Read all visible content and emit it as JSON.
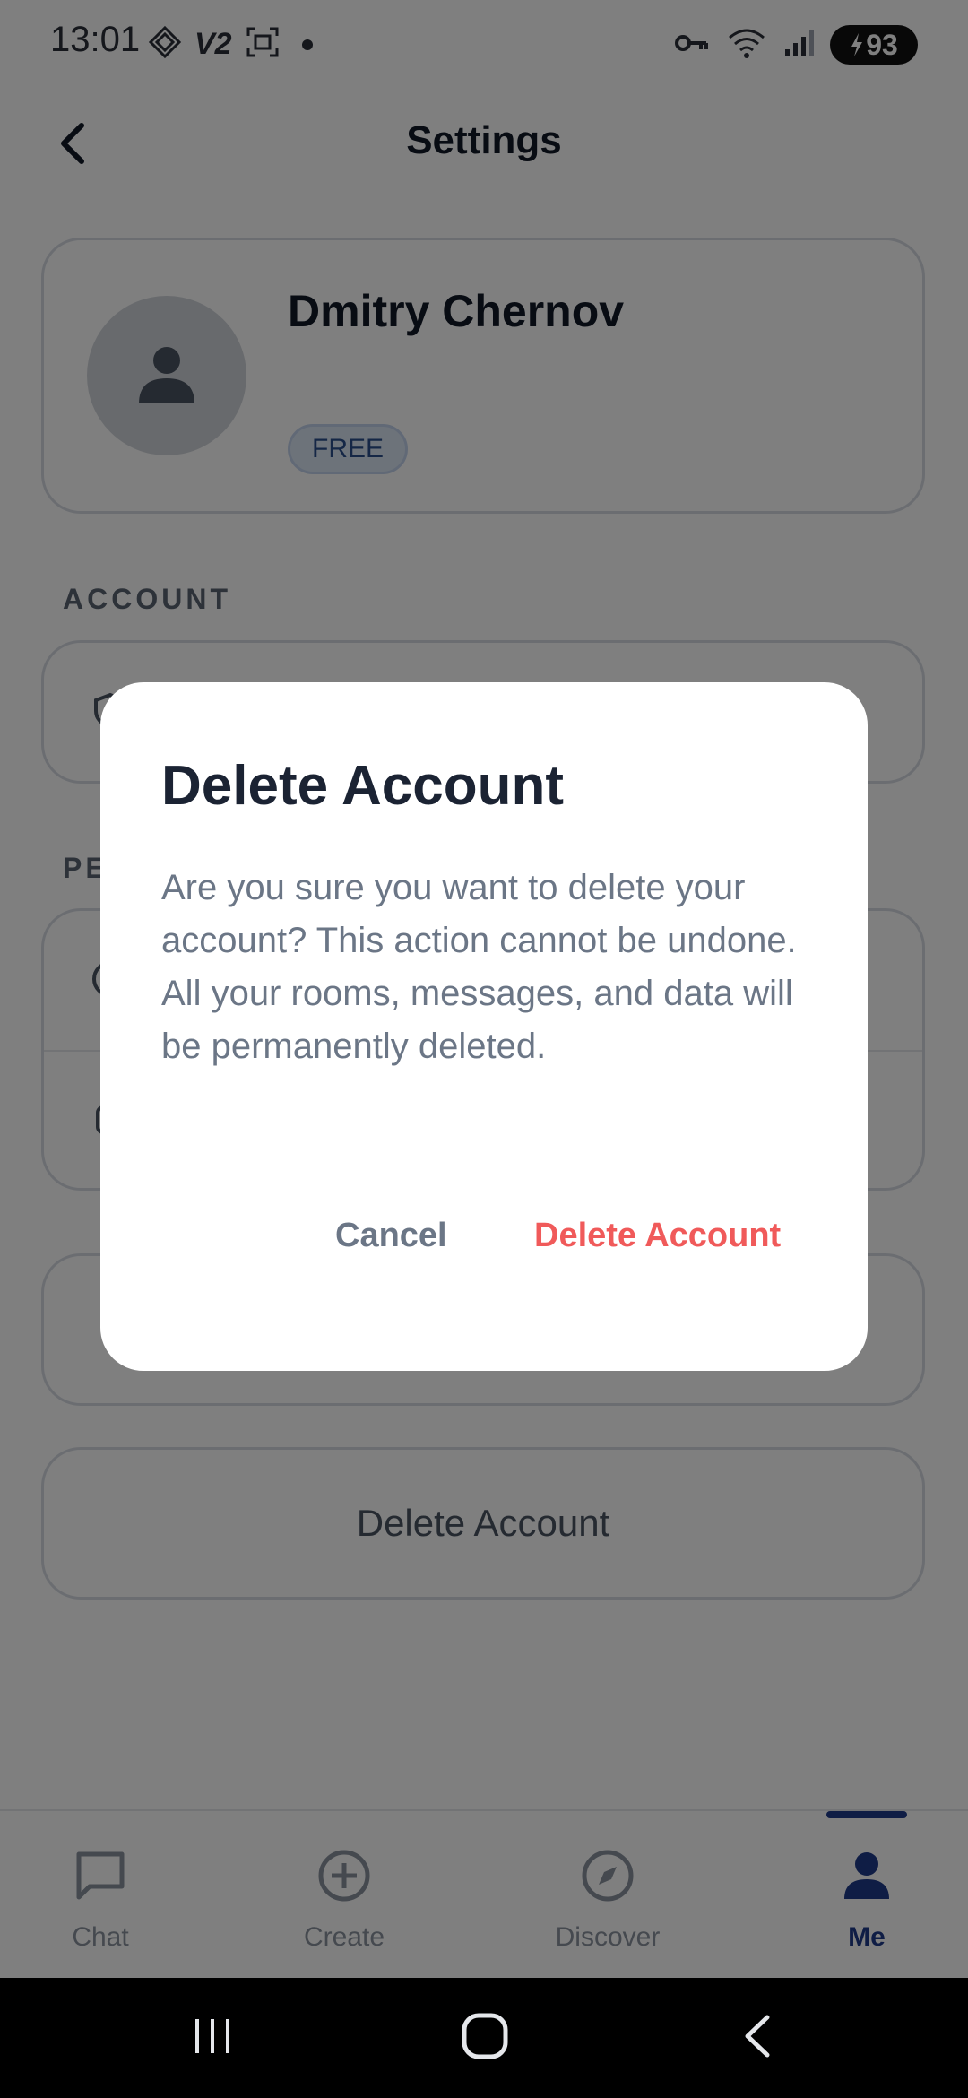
{
  "status_bar": {
    "time": "13:01",
    "network_label": "V2",
    "battery": "93"
  },
  "header": {
    "title": "Settings"
  },
  "profile": {
    "name": "Dmitry Chernov",
    "plan": "FREE"
  },
  "sections": {
    "account_label": "ACCOUNT",
    "second_label_partial": "PE"
  },
  "delete_account_button": "Delete Account",
  "bottom_nav": {
    "items": [
      {
        "label": "Chat",
        "icon": "chat-icon"
      },
      {
        "label": "Create",
        "icon": "plus-circle-icon"
      },
      {
        "label": "Discover",
        "icon": "compass-icon"
      },
      {
        "label": "Me",
        "icon": "person-icon"
      }
    ],
    "active": "Me",
    "active_color": "#1f3a8a"
  },
  "dialog": {
    "title": "Delete Account",
    "message": "Are you sure you want to delete your account? This action cannot be undone. All your rooms, messages, and data will be permanently deleted.",
    "cancel_label": "Cancel",
    "confirm_label": "Delete Account",
    "confirm_color": "#f05a5a"
  }
}
